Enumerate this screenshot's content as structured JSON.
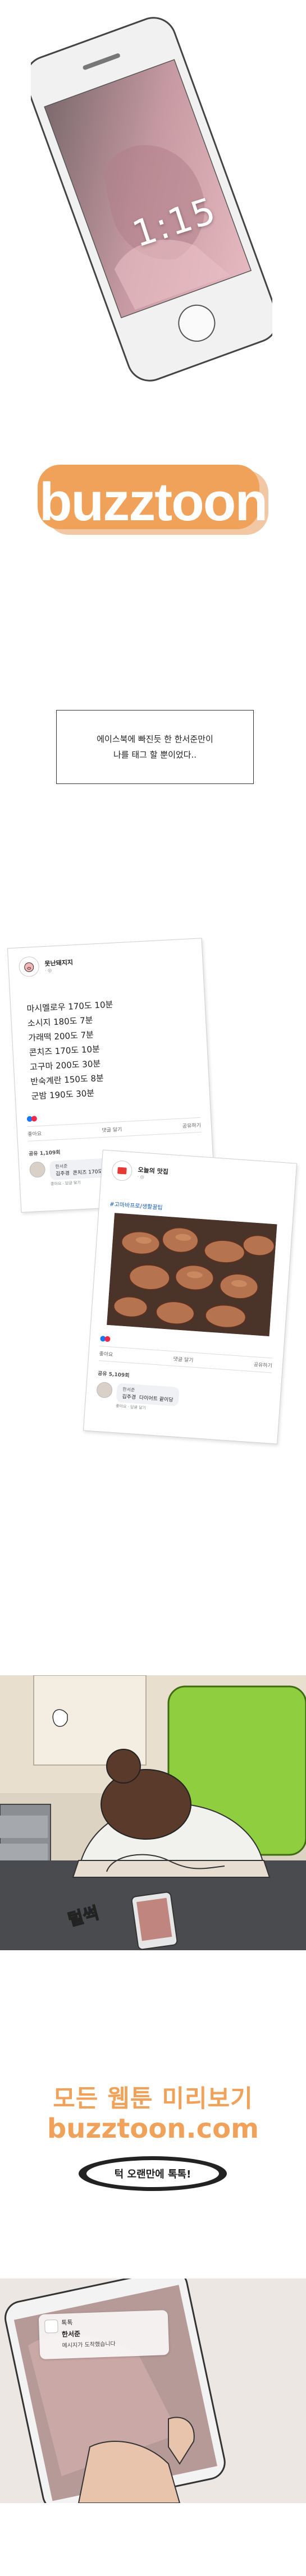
{
  "phone_lock": {
    "time": "1:15"
  },
  "logo": {
    "text": "buzztoon"
  },
  "caption": {
    "line1": "에이스북에 빠진듯 한 한서준만이",
    "line2": "나를 태그 할 뿐이었다.."
  },
  "post1": {
    "author": "못난돼지지",
    "list": [
      "마시멜로우 170도 10분",
      "소시지 180도 7분",
      "가래떡 200도 7분",
      "콘치즈 170도 10분",
      "고구마 200도 30분",
      "반숙계란 150도 8분",
      "군밤 190도 30분"
    ],
    "actions": [
      "좋아요",
      "댓글 달기",
      "공유하기"
    ],
    "shares": "공유 1,109회",
    "comment_author": "한서준",
    "comment_name": "김주경",
    "comment_text": "콘치즈 170도 10분",
    "comment_meta": "좋아요 · 답글 달기"
  },
  "post2": {
    "author": "오늘의 맛집",
    "hashtag": "#고마바프로/생활꿀팁",
    "actions": [
      "좋아요",
      "댓글 달기",
      "공유하기"
    ],
    "shares": "공유 5,109회",
    "comment_author": "한서준",
    "comment_name": "김주경",
    "comment_text": "다이어트 끝이당",
    "comment_meta": "좋아요 · 답글 달기"
  },
  "sfx": {
    "thud": "털썩"
  },
  "ad": {
    "line1": "모든 웹툰 미리보기",
    "line2": "buzztoon.com",
    "badge": "턱 오랜만에 톡톡!"
  },
  "notification": {
    "app": "톡톡",
    "name": "한서준",
    "message": "메시지가 도착했습니다"
  },
  "colors": {
    "logo_orange": "#f0a25a",
    "fb_blue": "#1877f2",
    "text": "#222222"
  }
}
